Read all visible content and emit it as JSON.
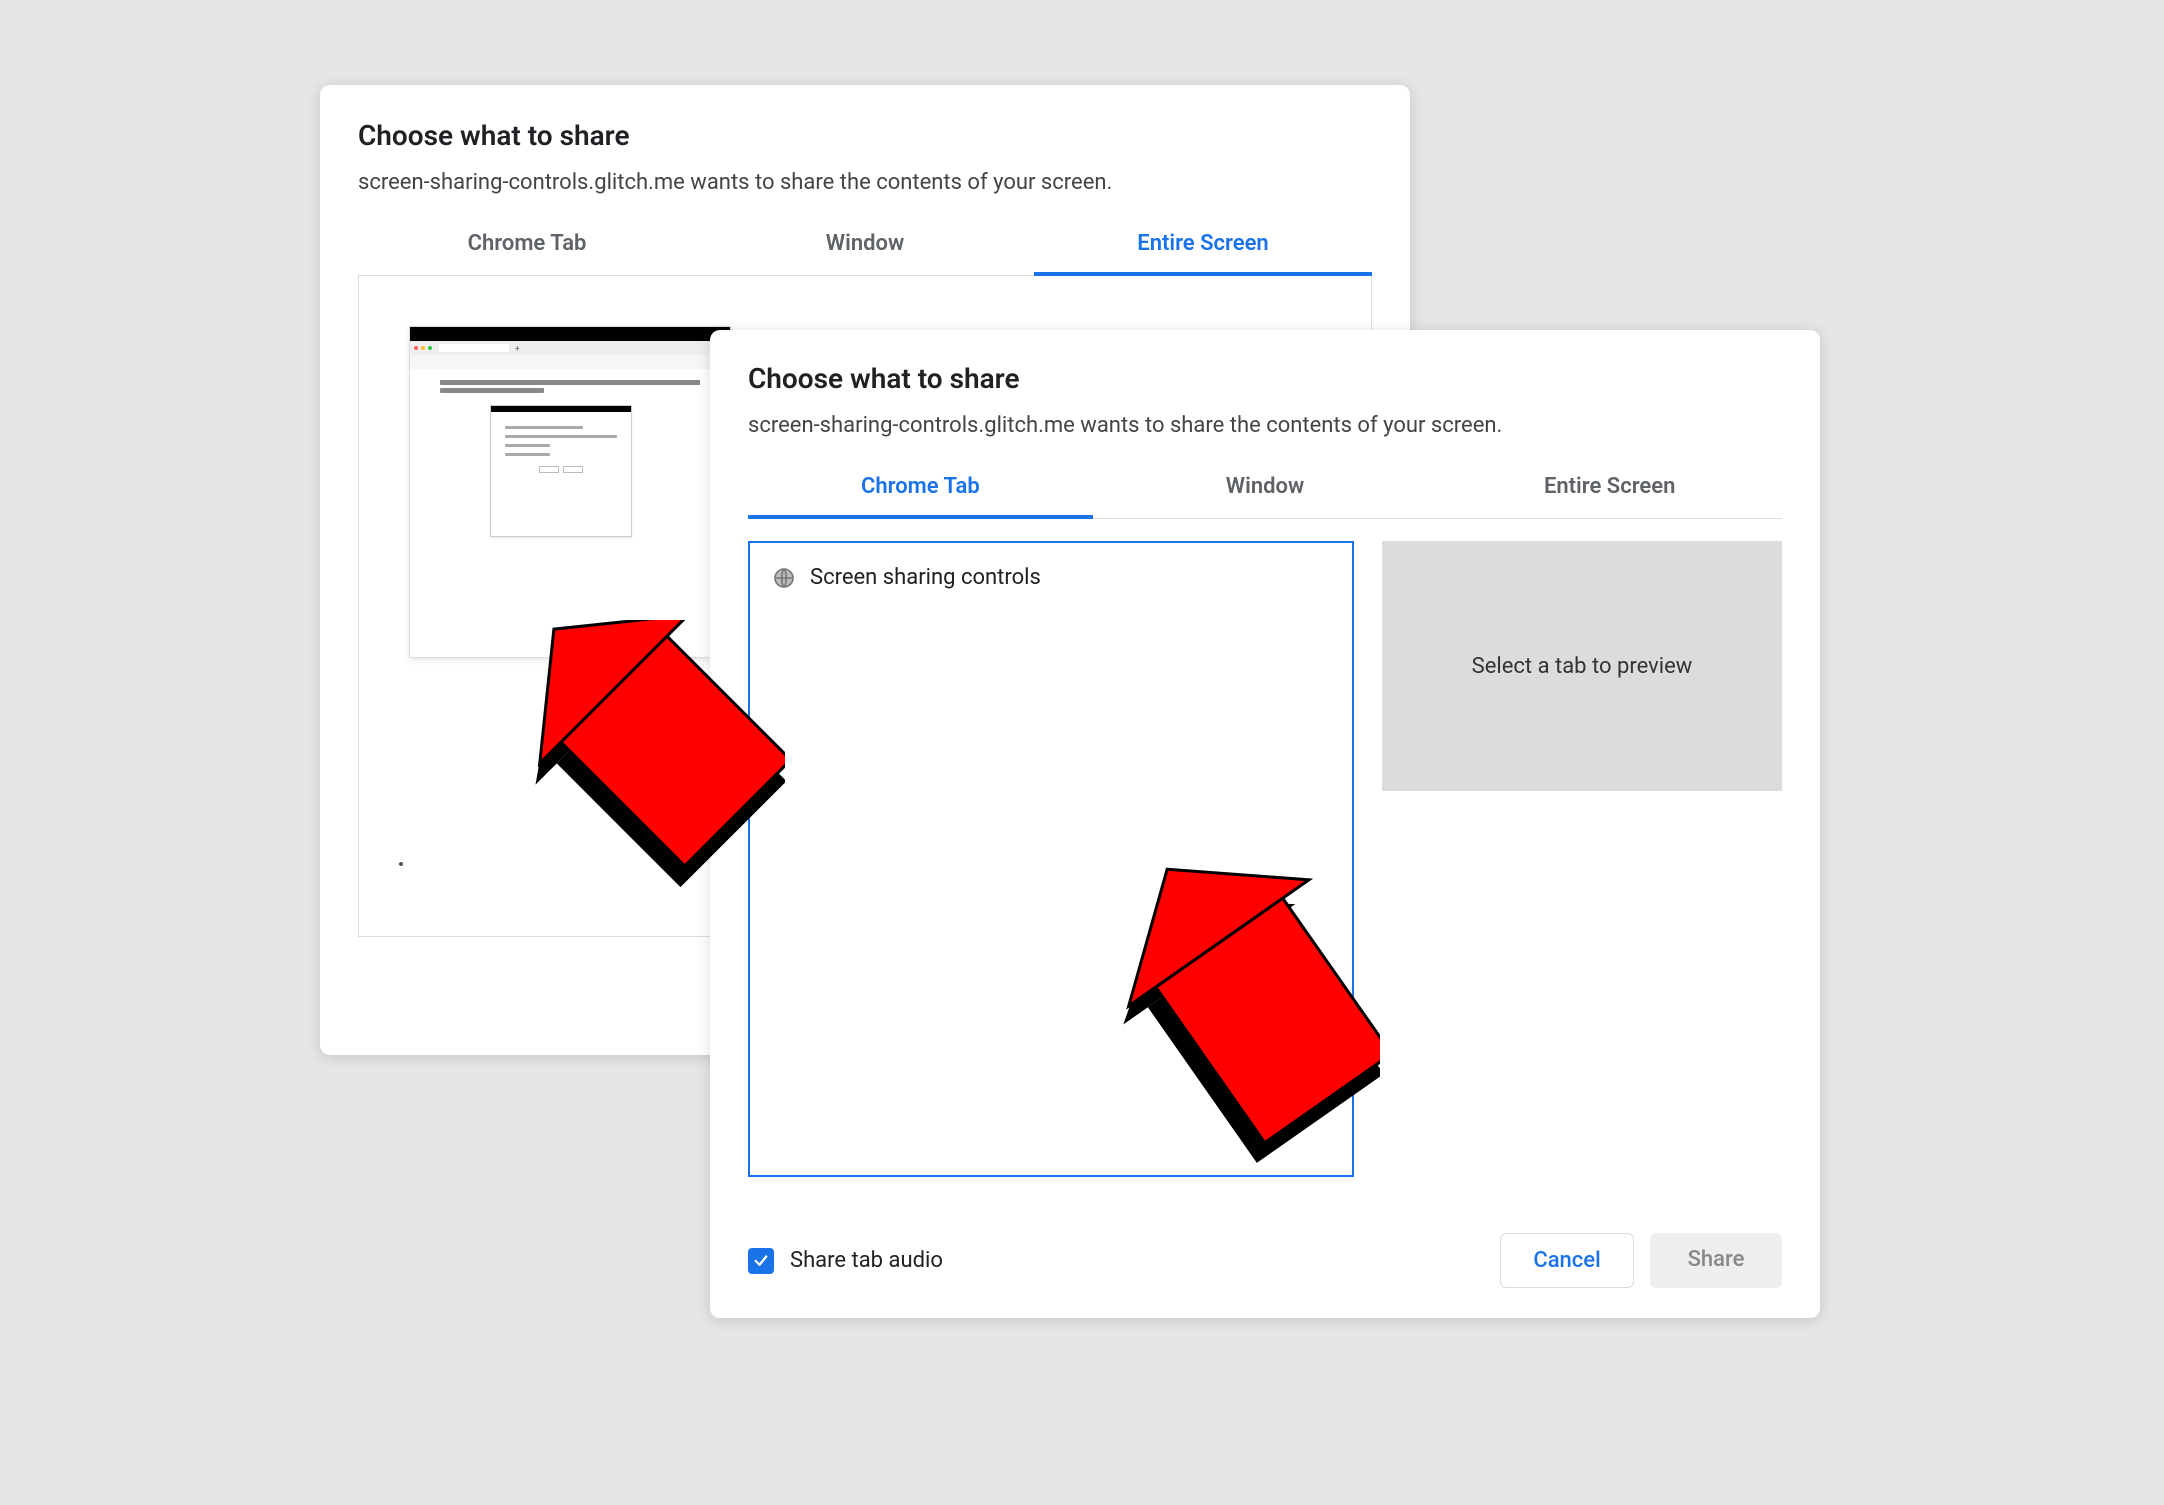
{
  "colors": {
    "accent": "#1a73e8",
    "page_bg": "#e6e6e6",
    "annotation_red": "#ff0000"
  },
  "back_dialog": {
    "title": "Choose what to share",
    "subtitle": "screen-sharing-controls.glitch.me wants to share the contents of your screen.",
    "tabs": [
      {
        "label": "Chrome Tab",
        "active": false
      },
      {
        "label": "Window",
        "active": false
      },
      {
        "label": "Entire Screen",
        "active": true
      }
    ]
  },
  "front_dialog": {
    "title": "Choose what to share",
    "subtitle": "screen-sharing-controls.glitch.me wants to share the contents of your screen.",
    "tabs": [
      {
        "label": "Chrome Tab",
        "active": true
      },
      {
        "label": "Window",
        "active": false
      },
      {
        "label": "Entire Screen",
        "active": false
      }
    ],
    "tab_list": [
      {
        "icon": "globe-icon",
        "label": "Screen sharing controls"
      }
    ],
    "preview_placeholder": "Select a tab to preview",
    "share_audio": {
      "checked": true,
      "label": "Share tab audio"
    },
    "buttons": {
      "cancel": "Cancel",
      "share": "Share"
    }
  }
}
